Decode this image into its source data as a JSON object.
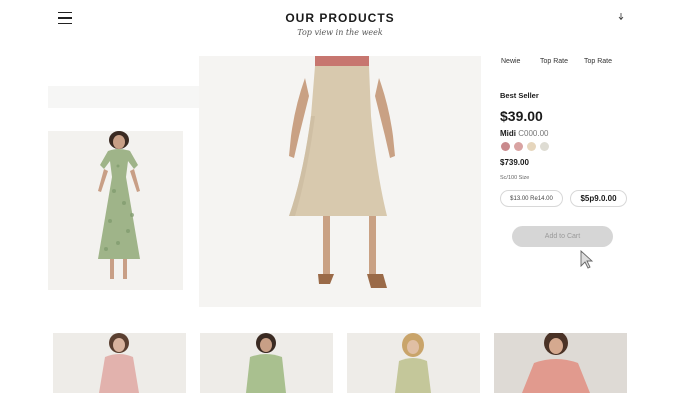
{
  "header": {
    "title": "OUR PRODUCTS",
    "subtitle": "Top view in the week",
    "download_glyph": "↓"
  },
  "icons": {
    "menu": "hamburger-icon",
    "download": "download-icon",
    "cursor": "mouse-pointer-icon"
  },
  "tabs": [
    "Newie",
    "Top Rate",
    "Top Rate"
  ],
  "product": {
    "badge": "Best Seller",
    "price": "$39.00",
    "name_main": "Midi",
    "name_suffix": "C000.00",
    "secondary_price": "$739.00",
    "size_label": "Sc/100 Size",
    "size_options": [
      "$13.00 Re14.00",
      "$5p9.0.00"
    ],
    "add_to_cart": "Add to Cart"
  },
  "colors": {
    "swatches": [
      "#c98a8d",
      "#d9a3a2",
      "#e6d6bd",
      "#dedcd3"
    ],
    "skirt": "#d8c9ae",
    "dress_green": "#9fb489",
    "button_bg": "#d6d6d6"
  }
}
